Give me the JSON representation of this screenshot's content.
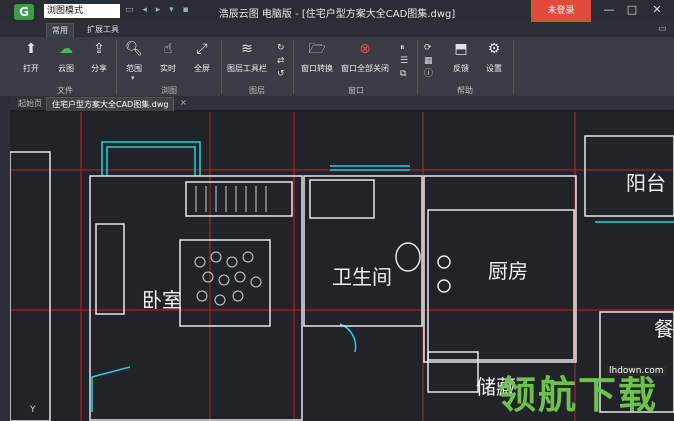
{
  "titlebar": {
    "mode": "浏图模式",
    "title": "浩辰云图 电脑版 - [住宅户型方案大全CAD图集.dwg]",
    "login": "未登录",
    "minimize": "—",
    "restore": "□",
    "close": "✕"
  },
  "ribbon": {
    "tabs": [
      "常用",
      "扩展工具"
    ],
    "buttons": {
      "open": "打开",
      "cloud": "云图",
      "share": "分享",
      "range": "范围",
      "realtime": "实时",
      "fullscreen": "全屏",
      "layer_toolbar": "图层工具栏",
      "window_switch": "窗口转换",
      "window_close_all": "窗口全部关闭",
      "feedback": "反馈",
      "settings": "设置"
    },
    "groups": {
      "file": "文件",
      "view": "浏图",
      "layer": "图层",
      "window": "窗口",
      "help": "帮助"
    }
  },
  "doc_tabs": {
    "start": "起始页",
    "active": "住宅户型方案大全CAD图集.dwg",
    "close": "×"
  },
  "drawing": {
    "rooms": [
      "卧室",
      "卫生间",
      "厨房",
      "阳台",
      "储藏",
      "餐"
    ],
    "axis_y": "Y"
  },
  "watermark": {
    "text": "领航下载",
    "url": "lhdown.com"
  },
  "colors": {
    "accent": "#3a9b4a",
    "login_bg": "#e24b3b",
    "wall_white": "#e8e8e8",
    "wall_cyan": "#28d0e0",
    "grid_red": "#c0202a"
  }
}
